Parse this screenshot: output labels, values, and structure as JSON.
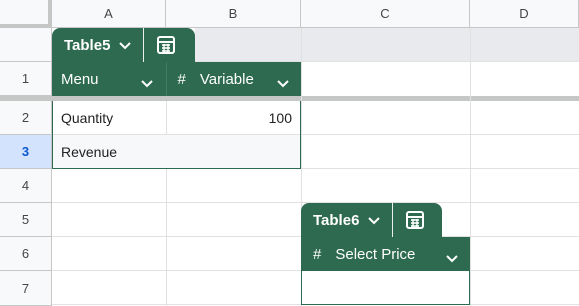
{
  "columns": [
    "A",
    "B",
    "C",
    "D"
  ],
  "rows": [
    "1",
    "2",
    "3",
    "4",
    "5",
    "6",
    "7"
  ],
  "table5": {
    "name": "Table5",
    "col1_header": "Menu",
    "col2_hash": "#",
    "col2_header": "Variable",
    "rows": [
      {
        "label": "Quantity",
        "value": "100"
      },
      {
        "label": "Revenue",
        "value": ""
      }
    ]
  },
  "table6": {
    "name": "Table6",
    "col_hash": "#",
    "col_header": "Select Price"
  },
  "colors": {
    "table_green": "#2d6a4f",
    "selected_row_header": "#d3e3fd",
    "header_bg": "#f8f9fa"
  },
  "icons": {
    "chevron": "chevron-down-icon",
    "table_view": "table-view-icon"
  }
}
